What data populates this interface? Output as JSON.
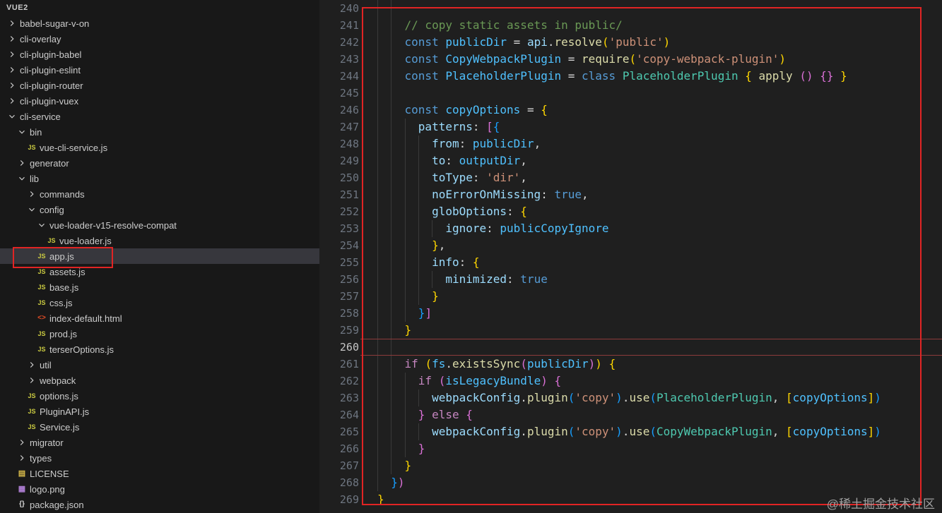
{
  "sidebar": {
    "title": "VUE2",
    "items": [
      {
        "label": "babel-sugar-v-on",
        "kind": "folder",
        "state": "collapsed",
        "level": 0
      },
      {
        "label": "cli-overlay",
        "kind": "folder",
        "state": "collapsed",
        "level": 0
      },
      {
        "label": "cli-plugin-babel",
        "kind": "folder",
        "state": "collapsed",
        "level": 0
      },
      {
        "label": "cli-plugin-eslint",
        "kind": "folder",
        "state": "collapsed",
        "level": 0
      },
      {
        "label": "cli-plugin-router",
        "kind": "folder",
        "state": "collapsed",
        "level": 0
      },
      {
        "label": "cli-plugin-vuex",
        "kind": "folder",
        "state": "collapsed",
        "level": 0
      },
      {
        "label": "cli-service",
        "kind": "folder",
        "state": "expanded",
        "level": 0
      },
      {
        "label": "bin",
        "kind": "folder",
        "state": "expanded",
        "level": 1
      },
      {
        "label": "vue-cli-service.js",
        "kind": "js",
        "level": 2
      },
      {
        "label": "generator",
        "kind": "folder",
        "state": "collapsed",
        "level": 1
      },
      {
        "label": "lib",
        "kind": "folder",
        "state": "expanded",
        "level": 1
      },
      {
        "label": "commands",
        "kind": "folder",
        "state": "collapsed",
        "level": 2
      },
      {
        "label": "config",
        "kind": "folder",
        "state": "expanded",
        "level": 2
      },
      {
        "label": "vue-loader-v15-resolve-compat",
        "kind": "folder",
        "state": "expanded",
        "level": 3
      },
      {
        "label": "vue-loader.js",
        "kind": "js",
        "level": 4
      },
      {
        "label": "app.js",
        "kind": "js",
        "level": 3,
        "selected": true,
        "annotated": true
      },
      {
        "label": "assets.js",
        "kind": "js",
        "level": 3
      },
      {
        "label": "base.js",
        "kind": "js",
        "level": 3
      },
      {
        "label": "css.js",
        "kind": "js",
        "level": 3
      },
      {
        "label": "index-default.html",
        "kind": "html",
        "level": 3
      },
      {
        "label": "prod.js",
        "kind": "js",
        "level": 3
      },
      {
        "label": "terserOptions.js",
        "kind": "js",
        "level": 3
      },
      {
        "label": "util",
        "kind": "folder",
        "state": "collapsed",
        "level": 2
      },
      {
        "label": "webpack",
        "kind": "folder",
        "state": "collapsed",
        "level": 2
      },
      {
        "label": "options.js",
        "kind": "js",
        "level": 2
      },
      {
        "label": "PluginAPI.js",
        "kind": "js",
        "level": 2
      },
      {
        "label": "Service.js",
        "kind": "js",
        "level": 2
      },
      {
        "label": "migrator",
        "kind": "folder",
        "state": "collapsed",
        "level": 1
      },
      {
        "label": "types",
        "kind": "folder",
        "state": "collapsed",
        "level": 1
      },
      {
        "label": "LICENSE",
        "kind": "license",
        "level": 1
      },
      {
        "label": "logo.png",
        "kind": "image",
        "level": 1
      },
      {
        "label": "package.json",
        "kind": "json",
        "level": 1
      }
    ]
  },
  "editor": {
    "active_line": 260,
    "lines": [
      {
        "num": 240,
        "tokens": []
      },
      {
        "num": 241,
        "tokens": [
          [
            "pn",
            "    "
          ],
          [
            "cmt",
            "// copy static assets in public/"
          ]
        ]
      },
      {
        "num": 242,
        "tokens": [
          [
            "pn",
            "    "
          ],
          [
            "kw",
            "const"
          ],
          [
            "pn",
            " "
          ],
          [
            "var",
            "publicDir"
          ],
          [
            "pn",
            " = "
          ],
          [
            "param",
            "api"
          ],
          [
            "pn",
            "."
          ],
          [
            "fn",
            "resolve"
          ],
          [
            "b1",
            "("
          ],
          [
            "str",
            "'public'"
          ],
          [
            "b1",
            ")"
          ]
        ]
      },
      {
        "num": 243,
        "tokens": [
          [
            "pn",
            "    "
          ],
          [
            "kw",
            "const"
          ],
          [
            "pn",
            " "
          ],
          [
            "var",
            "CopyWebpackPlugin"
          ],
          [
            "pn",
            " = "
          ],
          [
            "fn",
            "require"
          ],
          [
            "b1",
            "("
          ],
          [
            "str",
            "'copy-webpack-plugin'"
          ],
          [
            "b1",
            ")"
          ]
        ]
      },
      {
        "num": 244,
        "tokens": [
          [
            "pn",
            "    "
          ],
          [
            "kw",
            "const"
          ],
          [
            "pn",
            " "
          ],
          [
            "var",
            "PlaceholderPlugin"
          ],
          [
            "pn",
            " = "
          ],
          [
            "kw",
            "class"
          ],
          [
            "pn",
            " "
          ],
          [
            "cls",
            "PlaceholderPlugin"
          ],
          [
            "pn",
            " "
          ],
          [
            "b1",
            "{"
          ],
          [
            "pn",
            " "
          ],
          [
            "fn",
            "apply"
          ],
          [
            "pn",
            " "
          ],
          [
            "b2",
            "()"
          ],
          [
            "pn",
            " "
          ],
          [
            "b2",
            "{}"
          ],
          [
            "pn",
            " "
          ],
          [
            "b1",
            "}"
          ]
        ]
      },
      {
        "num": 245,
        "tokens": []
      },
      {
        "num": 246,
        "tokens": [
          [
            "pn",
            "    "
          ],
          [
            "kw",
            "const"
          ],
          [
            "pn",
            " "
          ],
          [
            "var",
            "copyOptions"
          ],
          [
            "pn",
            " = "
          ],
          [
            "b1",
            "{"
          ]
        ]
      },
      {
        "num": 247,
        "tokens": [
          [
            "pn",
            "      "
          ],
          [
            "param",
            "patterns"
          ],
          [
            "pn",
            ": "
          ],
          [
            "b2",
            "["
          ],
          [
            "b3",
            "{"
          ]
        ]
      },
      {
        "num": 248,
        "tokens": [
          [
            "pn",
            "        "
          ],
          [
            "param",
            "from"
          ],
          [
            "pn",
            ": "
          ],
          [
            "var",
            "publicDir"
          ],
          [
            "pn",
            ","
          ]
        ]
      },
      {
        "num": 249,
        "tokens": [
          [
            "pn",
            "        "
          ],
          [
            "param",
            "to"
          ],
          [
            "pn",
            ": "
          ],
          [
            "var",
            "outputDir"
          ],
          [
            "pn",
            ","
          ]
        ]
      },
      {
        "num": 250,
        "tokens": [
          [
            "pn",
            "        "
          ],
          [
            "param",
            "toType"
          ],
          [
            "pn",
            ": "
          ],
          [
            "str",
            "'dir'"
          ],
          [
            "pn",
            ","
          ]
        ]
      },
      {
        "num": 251,
        "tokens": [
          [
            "pn",
            "        "
          ],
          [
            "param",
            "noErrorOnMissing"
          ],
          [
            "pn",
            ": "
          ],
          [
            "kw",
            "true"
          ],
          [
            "pn",
            ","
          ]
        ]
      },
      {
        "num": 252,
        "tokens": [
          [
            "pn",
            "        "
          ],
          [
            "param",
            "globOptions"
          ],
          [
            "pn",
            ": "
          ],
          [
            "b1",
            "{"
          ]
        ]
      },
      {
        "num": 253,
        "tokens": [
          [
            "pn",
            "          "
          ],
          [
            "param",
            "ignore"
          ],
          [
            "pn",
            ": "
          ],
          [
            "var",
            "publicCopyIgnore"
          ]
        ]
      },
      {
        "num": 254,
        "tokens": [
          [
            "pn",
            "        "
          ],
          [
            "b1",
            "}"
          ],
          [
            "pn",
            ","
          ]
        ]
      },
      {
        "num": 255,
        "tokens": [
          [
            "pn",
            "        "
          ],
          [
            "param",
            "info"
          ],
          [
            "pn",
            ": "
          ],
          [
            "b1",
            "{"
          ]
        ]
      },
      {
        "num": 256,
        "tokens": [
          [
            "pn",
            "          "
          ],
          [
            "param",
            "minimized"
          ],
          [
            "pn",
            ": "
          ],
          [
            "kw",
            "true"
          ]
        ]
      },
      {
        "num": 257,
        "tokens": [
          [
            "pn",
            "        "
          ],
          [
            "b1",
            "}"
          ]
        ]
      },
      {
        "num": 258,
        "tokens": [
          [
            "pn",
            "      "
          ],
          [
            "b3",
            "}"
          ],
          [
            "b2",
            "]"
          ]
        ]
      },
      {
        "num": 259,
        "tokens": [
          [
            "pn",
            "    "
          ],
          [
            "b1",
            "}"
          ]
        ]
      },
      {
        "num": 260,
        "tokens": []
      },
      {
        "num": 261,
        "tokens": [
          [
            "pn",
            "    "
          ],
          [
            "ctrl",
            "if"
          ],
          [
            "pn",
            " "
          ],
          [
            "b1",
            "("
          ],
          [
            "var",
            "fs"
          ],
          [
            "pn",
            "."
          ],
          [
            "fn",
            "existsSync"
          ],
          [
            "b2",
            "("
          ],
          [
            "var",
            "publicDir"
          ],
          [
            "b2",
            ")"
          ],
          [
            "b1",
            ")"
          ],
          [
            "pn",
            " "
          ],
          [
            "b1",
            "{"
          ]
        ]
      },
      {
        "num": 262,
        "tokens": [
          [
            "pn",
            "      "
          ],
          [
            "ctrl",
            "if"
          ],
          [
            "pn",
            " "
          ],
          [
            "b2",
            "("
          ],
          [
            "var",
            "isLegacyBundle"
          ],
          [
            "b2",
            ")"
          ],
          [
            "pn",
            " "
          ],
          [
            "b2",
            "{"
          ]
        ]
      },
      {
        "num": 263,
        "tokens": [
          [
            "pn",
            "        "
          ],
          [
            "param",
            "webpackConfig"
          ],
          [
            "pn",
            "."
          ],
          [
            "fn",
            "plugin"
          ],
          [
            "b3",
            "("
          ],
          [
            "str",
            "'copy'"
          ],
          [
            "b3",
            ")"
          ],
          [
            "pn",
            "."
          ],
          [
            "fn",
            "use"
          ],
          [
            "b3",
            "("
          ],
          [
            "cls",
            "PlaceholderPlugin"
          ],
          [
            "pn",
            ", "
          ],
          [
            "b1",
            "["
          ],
          [
            "var",
            "copyOptions"
          ],
          [
            "b1",
            "]"
          ],
          [
            "b3",
            ")"
          ]
        ]
      },
      {
        "num": 264,
        "tokens": [
          [
            "pn",
            "      "
          ],
          [
            "b2",
            "}"
          ],
          [
            "pn",
            " "
          ],
          [
            "ctrl",
            "else"
          ],
          [
            "pn",
            " "
          ],
          [
            "b2",
            "{"
          ]
        ]
      },
      {
        "num": 265,
        "tokens": [
          [
            "pn",
            "        "
          ],
          [
            "param",
            "webpackConfig"
          ],
          [
            "pn",
            "."
          ],
          [
            "fn",
            "plugin"
          ],
          [
            "b3",
            "("
          ],
          [
            "str",
            "'copy'"
          ],
          [
            "b3",
            ")"
          ],
          [
            "pn",
            "."
          ],
          [
            "fn",
            "use"
          ],
          [
            "b3",
            "("
          ],
          [
            "cls",
            "CopyWebpackPlugin"
          ],
          [
            "pn",
            ", "
          ],
          [
            "b1",
            "["
          ],
          [
            "var",
            "copyOptions"
          ],
          [
            "b1",
            "]"
          ],
          [
            "b3",
            ")"
          ]
        ]
      },
      {
        "num": 266,
        "tokens": [
          [
            "pn",
            "      "
          ],
          [
            "b2",
            "}"
          ]
        ]
      },
      {
        "num": 267,
        "tokens": [
          [
            "pn",
            "    "
          ],
          [
            "b1",
            "}"
          ]
        ]
      },
      {
        "num": 268,
        "tokens": [
          [
            "pn",
            "  "
          ],
          [
            "b3",
            "}"
          ],
          [
            "b2",
            ")"
          ]
        ]
      },
      {
        "num": 269,
        "tokens": [
          [
            "b1",
            "}"
          ]
        ]
      }
    ]
  },
  "icons": {
    "js-file-icon": "JS",
    "html-file-icon": "<>",
    "json-file-icon": "{}",
    "license-icon": "▤",
    "image-file-icon": "▦"
  },
  "watermark": "@稀土掘金技术社区",
  "colors": {
    "editor_bg": "#1f1f1f",
    "sidebar_bg": "#181818",
    "text": "#cccccc",
    "annotation_red": "#e12424",
    "selected_row_bg": "#37373d",
    "line_number": "#6e7681",
    "line_number_active": "#c6c6c6",
    "active_line_border": "#8d3b3b",
    "indent_guide": "#3a3a3a",
    "syn_kw": "#569cd6",
    "syn_ctrl": "#c586c0",
    "syn_var": "#4fc1ff",
    "syn_param": "#9cdcfe",
    "syn_fn": "#dcdcaa",
    "syn_cls": "#4ec9b0",
    "syn_str": "#ce9178",
    "syn_cmt": "#6a9955",
    "syn_pn": "#d4d4d4",
    "bracket1": "#ffd700",
    "bracket2": "#da70d6",
    "bracket3": "#179fff",
    "icon_js": "#cbcb41",
    "icon_html": "#e44d26",
    "icon_json": "#d7d7d7",
    "icon_license": "#d7ba4a",
    "icon_image": "#b180d7",
    "watermark": "#a0a0a0"
  }
}
